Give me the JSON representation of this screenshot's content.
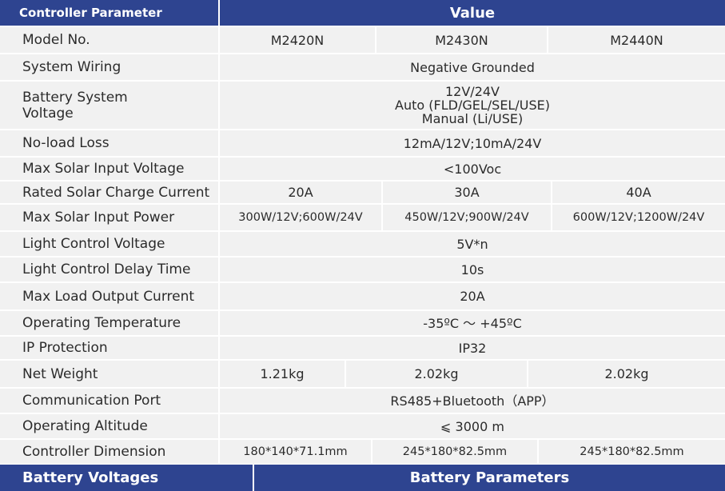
{
  "header": {
    "col1": "Controller Parameter",
    "col2": "Value"
  },
  "rows": {
    "model_no": {
      "label": "Model No.",
      "v1": "M2420N",
      "v2": "M2430N",
      "v3": "M2440N"
    },
    "system_wiring": {
      "label": "System Wiring",
      "value": "Negative Grounded"
    },
    "battery_voltage": {
      "label_line1": "Battery System",
      "label_line2": "Voltage",
      "line1": "12V/24V",
      "line2": "Auto (FLD/GEL/SEL/USE)",
      "line3": "Manual (Li/USE)"
    },
    "no_load_loss": {
      "label": "No-load Loss",
      "value": "12mA/12V;10mA/24V"
    },
    "max_solar_input_voltage": {
      "label": "Max Solar Input Voltage",
      "value": "<100Voc"
    },
    "rated_solar_charge_current": {
      "label": "Rated Solar Charge Current",
      "v1": "20A",
      "v2": "30A",
      "v3": "40A"
    },
    "max_solar_input_power": {
      "label": "Max Solar Input Power",
      "v1": "300W/12V;600W/24V",
      "v2": "450W/12V;900W/24V",
      "v3": "600W/12V;1200W/24V"
    },
    "light_control_voltage": {
      "label": "Light Control Voltage",
      "value": "5V*n"
    },
    "light_control_delay": {
      "label": "Light Control Delay Time",
      "value": "10s"
    },
    "max_load_output_current": {
      "label": "Max Load Output Current",
      "value": "20A"
    },
    "operating_temperature": {
      "label": "Operating Temperature",
      "value": "-35ºC ～ +45ºC"
    },
    "ip_protection": {
      "label": "IP Protection",
      "value": "IP32"
    },
    "net_weight": {
      "label": "Net Weight",
      "v1": "1.21kg",
      "v2": "2.02kg",
      "v3": "2.02kg"
    },
    "communication_port": {
      "label": "Communication Port",
      "value": "RS485+Bluetooth（APP）"
    },
    "operating_altitude": {
      "label": "Operating Altitude",
      "value": "⩽ 3000 m"
    },
    "controller_dimension": {
      "label": "Controller Dimension",
      "v1": "180*140*71.1mm",
      "v2": "245*180*82.5mm",
      "v3": "245*180*82.5mm"
    }
  },
  "footer": {
    "col1": "Battery Voltages",
    "col2": "Battery Parameters"
  },
  "colors": {
    "header_bg": "#2e4490",
    "row_bg": "#f1f1f1",
    "text": "#2b2b2b"
  }
}
